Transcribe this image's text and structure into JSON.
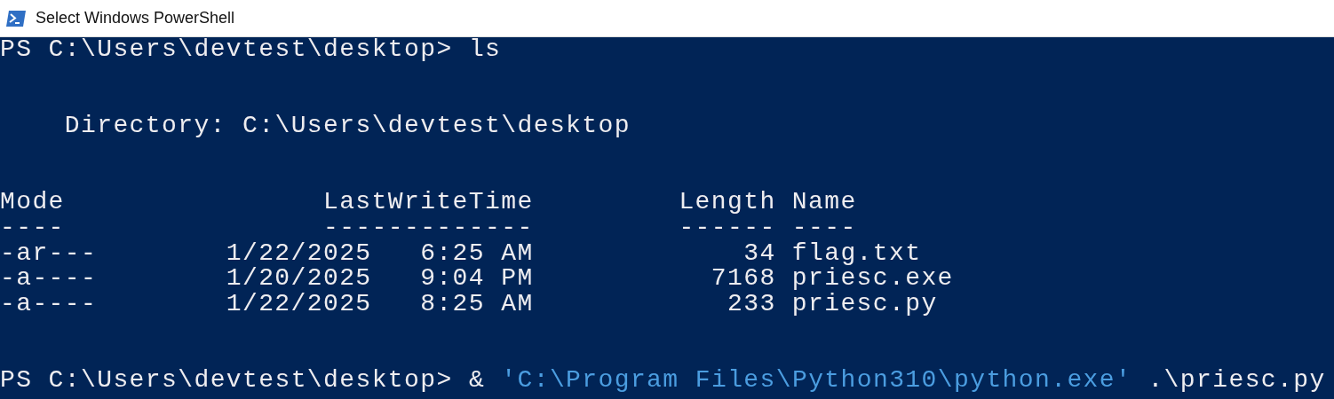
{
  "window": {
    "title": "Select Windows PowerShell"
  },
  "blocks": [
    {
      "kind": "command",
      "prompt": "PS C:\\Users\\devtest\\desktop> ",
      "parts": [
        {
          "kind": "plain",
          "text": "ls"
        }
      ]
    },
    {
      "kind": "directory",
      "text": "Directory: C:\\Users\\devtest\\desktop"
    },
    {
      "kind": "table",
      "columns": [
        "Mode",
        "LastWriteTime",
        "Length",
        "Name"
      ],
      "rules": [
        "----",
        "-------------",
        "------",
        "----"
      ],
      "rows": [
        {
          "mode": "-ar---",
          "date": "1/22/2025",
          "time": "6:25 AM",
          "length": "34",
          "name": "flag.txt"
        },
        {
          "mode": "-a----",
          "date": "1/20/2025",
          "time": "9:04 PM",
          "length": "7168",
          "name": "priesc.exe"
        },
        {
          "mode": "-a----",
          "date": "1/22/2025",
          "time": "8:25 AM",
          "length": "233",
          "name": "priesc.py"
        }
      ]
    },
    {
      "kind": "command",
      "prompt": "PS C:\\Users\\devtest\\desktop> ",
      "parts": [
        {
          "kind": "operator",
          "text": "& "
        },
        {
          "kind": "string",
          "text": "'C:\\Program Files\\Python310\\python.exe'"
        },
        {
          "kind": "plain",
          "text": " .\\priesc.py"
        }
      ]
    }
  ]
}
